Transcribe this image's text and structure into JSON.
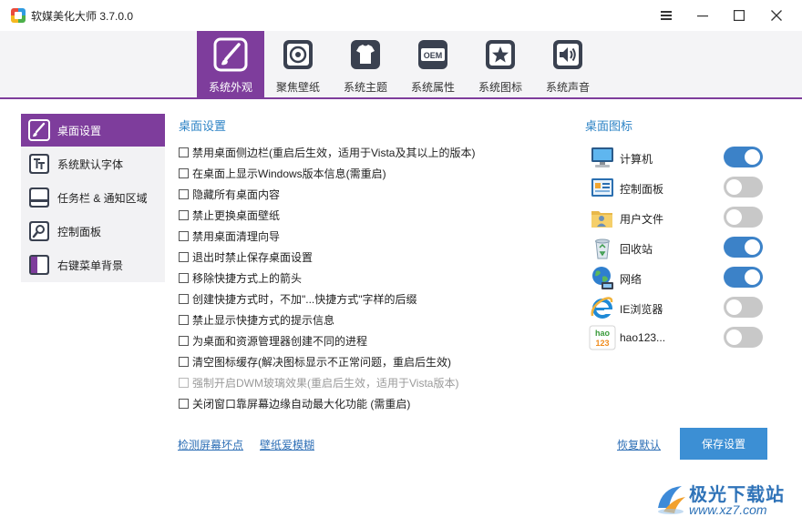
{
  "window": {
    "title": "软媒美化大师 3.7.0.0",
    "controls": [
      "menu-icon",
      "minimize-icon",
      "maximize-icon",
      "close-icon"
    ]
  },
  "top_tabs": [
    {
      "label": "系统外观",
      "icon": "brush-icon",
      "active": true
    },
    {
      "label": "聚焦壁纸",
      "icon": "wallpaper-icon",
      "active": false
    },
    {
      "label": "系统主题",
      "icon": "tshirt-icon",
      "active": false
    },
    {
      "label": "系统属性",
      "icon": "oem-icon",
      "active": false
    },
    {
      "label": "系统图标",
      "icon": "star-icon",
      "active": false
    },
    {
      "label": "系统声音",
      "icon": "speaker-icon",
      "active": false
    }
  ],
  "oem_icon_text": "OEM",
  "sidebar": {
    "items": [
      {
        "label": "桌面设置",
        "icon": "desktop-settings-icon",
        "active": true
      },
      {
        "label": "系统默认字体",
        "icon": "font-icon",
        "active": false
      },
      {
        "label": "任务栏 & 通知区域",
        "icon": "taskbar-icon",
        "active": false
      },
      {
        "label": "控制面板",
        "icon": "control-panel-icon",
        "active": false
      },
      {
        "label": "右键菜单背景",
        "icon": "context-menu-icon",
        "active": false
      }
    ]
  },
  "desktop_settings": {
    "title": "桌面设置",
    "options": [
      {
        "label": "禁用桌面侧边栏(重启后生效，适用于Vista及其以上的版本)",
        "checked": false,
        "disabled": false
      },
      {
        "label": "在桌面上显示Windows版本信息(需重启)",
        "checked": false,
        "disabled": false
      },
      {
        "label": "隐藏所有桌面内容",
        "checked": false,
        "disabled": false
      },
      {
        "label": "禁止更换桌面壁纸",
        "checked": false,
        "disabled": false
      },
      {
        "label": "禁用桌面清理向导",
        "checked": false,
        "disabled": false
      },
      {
        "label": "退出时禁止保存桌面设置",
        "checked": false,
        "disabled": false
      },
      {
        "label": "移除快捷方式上的箭头",
        "checked": false,
        "disabled": false
      },
      {
        "label": "创建快捷方式时，不加\"...快捷方式\"字样的后缀",
        "checked": false,
        "disabled": false
      },
      {
        "label": "禁止显示快捷方式的提示信息",
        "checked": false,
        "disabled": false
      },
      {
        "label": "为桌面和资源管理器创建不同的进程",
        "checked": false,
        "disabled": false
      },
      {
        "label": "清空图标缓存(解决图标显示不正常问题，重启后生效)",
        "checked": false,
        "disabled": false
      },
      {
        "label": "强制开启DWM玻璃效果(重启后生效，适用于Vista版本)",
        "checked": false,
        "disabled": true
      },
      {
        "label": "关闭窗口靠屏幕边缘自动最大化功能 (需重启)",
        "checked": false,
        "disabled": false
      }
    ]
  },
  "desktop_icons": {
    "title": "桌面图标",
    "items": [
      {
        "label": "计算机",
        "icon": "computer-icon",
        "enabled": true
      },
      {
        "label": "控制面板",
        "icon": "control-panel-icon",
        "enabled": false
      },
      {
        "label": "用户文件",
        "icon": "user-folder-icon",
        "enabled": false
      },
      {
        "label": "回收站",
        "icon": "recycle-bin-icon",
        "enabled": true
      },
      {
        "label": "网络",
        "icon": "network-icon",
        "enabled": true
      },
      {
        "label": "IE浏览器",
        "icon": "ie-icon",
        "enabled": false
      },
      {
        "label": "hao123...",
        "icon": "hao123-icon",
        "enabled": false
      }
    ]
  },
  "hao123_icon_text": {
    "top": "hao",
    "bottom": "123"
  },
  "footer": {
    "link_screen_test": "检测屏幕坏点",
    "link_wallpaper_blur": "壁纸爱模糊",
    "link_restore_default": "恢复默认",
    "save_button": "保存设置"
  },
  "watermark": {
    "title": "极光下载站",
    "url": "www.xz7.com"
  },
  "colors": {
    "accent_purple": "#7e3d9c",
    "link_blue": "#2e6fb6",
    "section_blue": "#2e84c6",
    "toggle_on": "#3c82c8",
    "toggle_off": "#c8c8c8",
    "save_button": "#3c8fd4"
  }
}
